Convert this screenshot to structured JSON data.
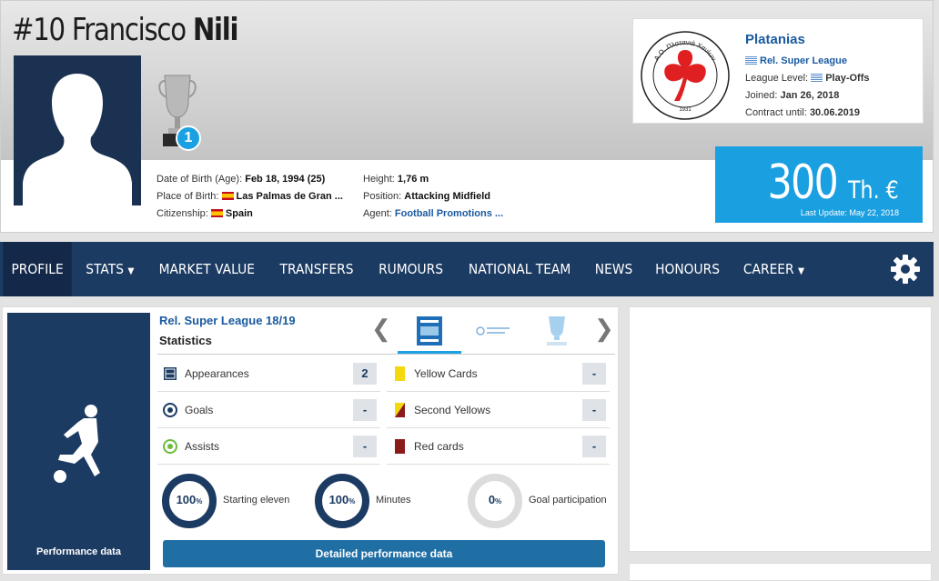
{
  "player": {
    "number": "#10",
    "first_name": "Francisco",
    "last_name": "Nili",
    "trophy_count": "1"
  },
  "info": {
    "dob_label": "Date of Birth (Age):",
    "dob_value": "Feb 18, 1994 (25)",
    "pob_label": "Place of Birth:",
    "pob_value": "Las Palmas de Gran ...",
    "citizenship_label": "Citizenship:",
    "citizenship_value": "Spain",
    "height_label": "Height:",
    "height_value": "1,76 m",
    "position_label": "Position:",
    "position_value": "Attacking Midfield",
    "agent_label": "Agent:",
    "agent_value": "Football Promotions ..."
  },
  "club": {
    "name": "Platanias",
    "league": "Rel. Super League",
    "league_level_label": "League Level:",
    "league_level_value": "Play-Offs",
    "joined_label": "Joined:",
    "joined_value": "Jan 26, 2018",
    "contract_label": "Contract until:",
    "contract_value": "30.06.2019",
    "logo_text": "Α.Ο. Πλατανιά Χανίων",
    "logo_year": "1931"
  },
  "market_value": {
    "value": "300",
    "unit": "Th. €",
    "last_update": "Last Update: May 22, 2018"
  },
  "nav": {
    "items": [
      "PROFILE",
      "STATS",
      "MARKET VALUE",
      "TRANSFERS",
      "RUMOURS",
      "NATIONAL TEAM",
      "NEWS",
      "HONOURS",
      "CAREER"
    ]
  },
  "performance": {
    "side_label": "Performance data",
    "league_title": "Rel. Super League 18/19",
    "stats_title": "Statistics",
    "stats_left": [
      {
        "label": "Appearances",
        "value": "2"
      },
      {
        "label": "Goals",
        "value": "-"
      },
      {
        "label": "Assists",
        "value": "-"
      }
    ],
    "stats_right": [
      {
        "label": "Yellow Cards",
        "value": "-"
      },
      {
        "label": "Second Yellows",
        "value": "-"
      },
      {
        "label": "Red cards",
        "value": "-"
      }
    ],
    "rings": [
      {
        "value": "100",
        "unit": "%",
        "label": "Starting eleven",
        "fraction": 1.0
      },
      {
        "value": "100",
        "unit": "%",
        "label": "Minutes",
        "fraction": 1.0
      },
      {
        "value": "0",
        "unit": "%",
        "label": "Goal participation",
        "fraction": 0.0
      }
    ],
    "detail_button": "Detailed performance data"
  },
  "colors": {
    "navy": "#1c3b62",
    "accent_blue": "#1a9fe0",
    "link": "#1a5aa0",
    "yellow_card": "#f5d90f",
    "red_card": "#8b1a1a"
  }
}
